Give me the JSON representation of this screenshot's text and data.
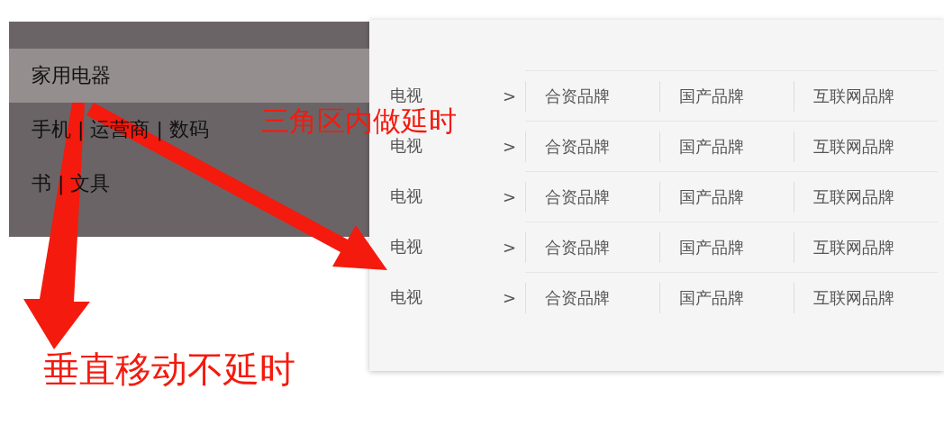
{
  "menu": {
    "items": [
      {
        "label": "家用电器",
        "selected": true
      },
      {
        "label": "手机 | 运营商 | 数码",
        "selected": false
      },
      {
        "label": "书 | 文具",
        "selected": false
      }
    ]
  },
  "submenu": {
    "rows": [
      {
        "category": "电视",
        "arrow": ">",
        "brands": [
          "合资品牌",
          "国产品牌",
          "互联网品牌"
        ]
      },
      {
        "category": "电视",
        "arrow": ">",
        "brands": [
          "合资品牌",
          "国产品牌",
          "互联网品牌"
        ]
      },
      {
        "category": "电视",
        "arrow": ">",
        "brands": [
          "合资品牌",
          "国产品牌",
          "互联网品牌"
        ]
      },
      {
        "category": "电视",
        "arrow": ">",
        "brands": [
          "合资品牌",
          "国产品牌",
          "互联网品牌"
        ]
      },
      {
        "category": "电视",
        "arrow": ">",
        "brands": [
          "合资品牌",
          "国产品牌",
          "互联网品牌"
        ]
      }
    ]
  },
  "annotations": [
    {
      "kind": "diagonal",
      "text": "三角区内做延时"
    },
    {
      "kind": "vertical",
      "text": "垂直移动不延时"
    }
  ]
}
